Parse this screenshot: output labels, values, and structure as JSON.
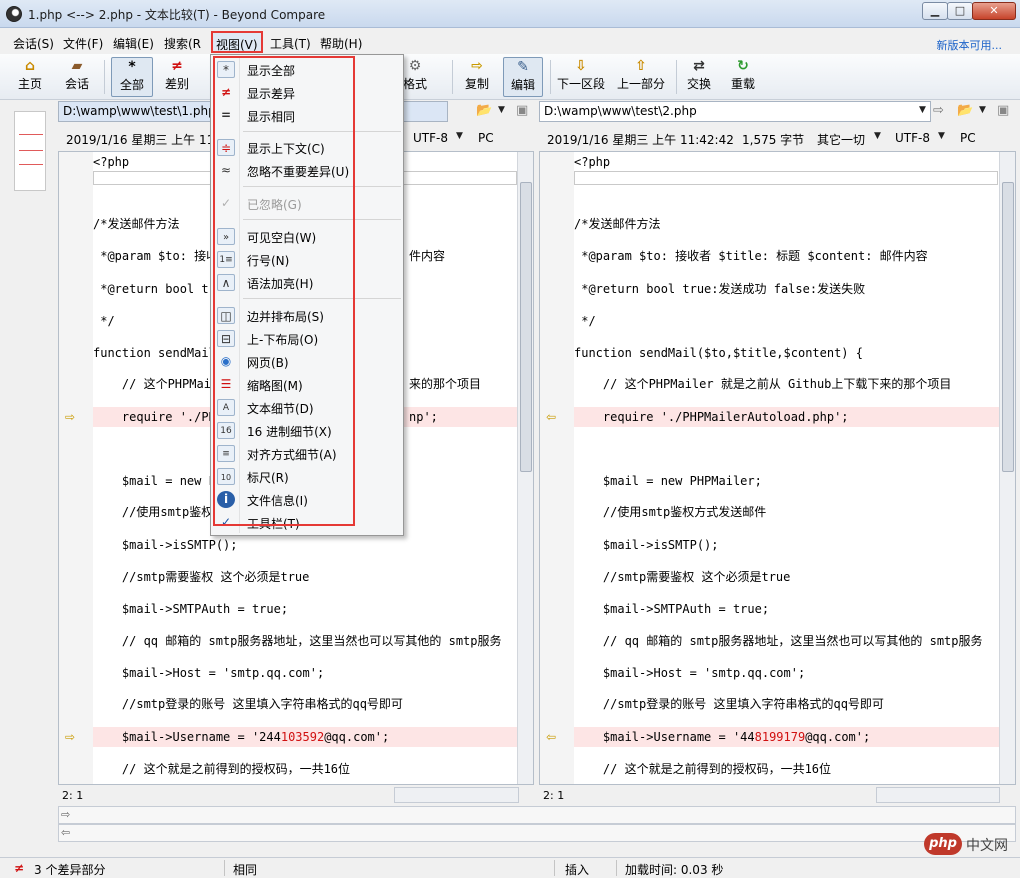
{
  "window": {
    "title": "1.php <--> 2.php - 文本比较(T) - Beyond Compare",
    "min": "▁",
    "max": "□",
    "close": "✕"
  },
  "menu": {
    "items": [
      "会话(S)",
      "文件(F)",
      "编辑(E)",
      "搜索(R",
      "视图(V)",
      "工具(T)",
      "帮助(H)"
    ],
    "new_version": "新版本可用..."
  },
  "toolbar": {
    "home": "主页",
    "session": "会话",
    "all": "全部",
    "diff": "差别",
    "format": "格式",
    "copy": "复制",
    "edit": "编辑",
    "next": "下一区段",
    "prev": "上一部分",
    "swap": "交换",
    "reload": "重载"
  },
  "left": {
    "path": "D:\\wamp\\www\\test\\1.php",
    "date": "2019/1/16 星期三 上午 11",
    "encoding": "UTF-8",
    "eol": "PC",
    "position": "2: 1"
  },
  "right": {
    "path": "D:\\wamp\\www\\test\\2.php",
    "date": "2019/1/16 星期三 上午 11:42:42",
    "size": "1,575 字节",
    "other": "其它一切",
    "encoding": "UTF-8",
    "eol": "PC",
    "position": "2: 1"
  },
  "code_left": {
    "l1": "<?php",
    "l2": "/*发送邮件方法",
    "l3": " *@param $to: 接收",
    "l3b": "件内容",
    "l4": " *@return bool tr",
    "l5": " */",
    "l6": "function sendMail",
    "l7": "    // 这个PHPMail",
    "l7b": "来的那个项目",
    "l8": "    require './PH",
    "l8b": "np';",
    "l9": "    $mail = new P",
    "l10": "    //使用smtp鉴权",
    "l11": "    $mail->isSMTP();",
    "l12": "    //smtp需要鉴权 这个必须是true",
    "l13": "    $mail->SMTPAuth = true;",
    "l14": "    // qq 邮箱的 smtp服务器地址，这里当然也可以写其他的 smtp服务",
    "l15": "    $mail->Host = 'smtp.qq.com';",
    "l16": "    //smtp登录的账号 这里填入字符串格式的qq号即可",
    "l17a": "    $mail->Username = '244",
    "l17b": "103592",
    "l17c": "@qq.com';",
    "l18": "    // 这个就是之前得到的授权码，一共16位"
  },
  "code_right": {
    "l1": "<?php",
    "l2": "/*发送邮件方法",
    "l3": " *@param $to: 接收者 $title: 标题 $content: 邮件内容",
    "l4": " *@return bool true:发送成功 false:发送失败",
    "l5": " */",
    "l6": "function sendMail($to,$title,$content) {",
    "l7": "    // 这个PHPMailer 就是之前从 Github上下载下来的那个项目",
    "l8": "    require './PHPMailerAutoload.php';",
    "l9": "    $mail = new PHPMailer;",
    "l10": "    //使用smtp鉴权方式发送邮件",
    "l11": "    $mail->isSMTP();",
    "l12": "    //smtp需要鉴权 这个必须是true",
    "l13": "    $mail->SMTPAuth = true;",
    "l14": "    // qq 邮箱的 smtp服务器地址，这里当然也可以写其他的 smtp服务",
    "l15": "    $mail->Host = 'smtp.qq.com';",
    "l16": "    //smtp登录的账号 这里填入字符串格式的qq号即可",
    "l17a": "    $mail->Username = '44",
    "l17b": "8199179",
    "l17c": "@qq.com';",
    "l18": "    // 这个就是之前得到的授权码，一共16位"
  },
  "view_menu": {
    "show_all": "显示全部",
    "show_diff": "显示差异",
    "show_same": "显示相同",
    "show_context": "显示上下文(C)",
    "ignore_minor": "忽略不重要差异(U)",
    "ignored": "已忽略(G)",
    "visible_whitespace": "可见空白(W)",
    "line_numbers": "行号(N)",
    "syntax_highlight": "语法加亮(H)",
    "side_by_side": "边并排布局(S)",
    "over_under": "上-下布局(O)",
    "web": "网页(B)",
    "thumbnail": "缩略图(M)",
    "text_details": "文本细节(D)",
    "hex_details": "16 进制细节(X)",
    "align_details": "对齐方式细节(A)",
    "ruler": "标尺(R)",
    "file_info": "文件信息(I)",
    "toolbar": "工具栏(T)"
  },
  "status": {
    "diff_count": "3 个差异部分",
    "same": "相同",
    "insert": "插入",
    "load_time": "加载时间: 0.03 秒"
  },
  "watermark": {
    "badge": "php",
    "text": "中文网"
  },
  "colors": {
    "accent_red": "#e53935",
    "diff_bg": "#fde5e5",
    "diff_text": "#d01010"
  }
}
